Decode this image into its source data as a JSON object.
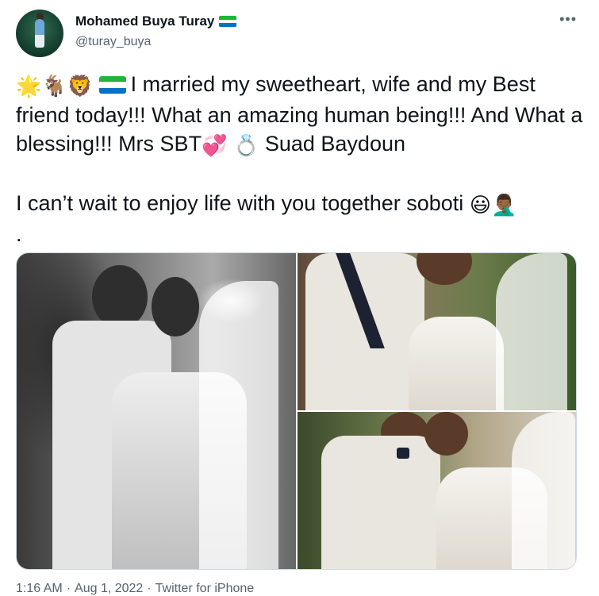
{
  "author": {
    "display_name": "Mohamed Buya Turay",
    "handle": "@turay_buya",
    "flag_colors": [
      "#1eb53a",
      "#ffffff",
      "#0072c6"
    ]
  },
  "more_menu": {
    "icon": "more-horizontal-icon",
    "glyph": "•••"
  },
  "tweet": {
    "line1_emojis": [
      "🌟",
      "🐐",
      "🦁"
    ],
    "line1_text": "I married my sweetheart, wife and my Best friend today!!! What an amazing human being!!! And What a blessing!!! Mrs SBT",
    "emoji_hearts": "💞",
    "emoji_ring": "💍",
    "line1_tail": "Suad Baydoun",
    "line2_text": "I can’t wait to enjoy life with you together soboti",
    "emoji_smile": "😃",
    "emoji_facepalm": "🤦🏾‍♂️",
    "line3_text": "."
  },
  "media": {
    "photos": [
      {
        "name": "wedding-photo-black-white",
        "style": "monochrome"
      },
      {
        "name": "wedding-photo-kiss-closeup",
        "style": "color"
      },
      {
        "name": "wedding-photo-kiss-bowtie",
        "style": "color"
      }
    ]
  },
  "meta": {
    "time": "1:16 AM",
    "separator": "·",
    "date": "Aug 1, 2022",
    "source": "Twitter for iPhone"
  }
}
